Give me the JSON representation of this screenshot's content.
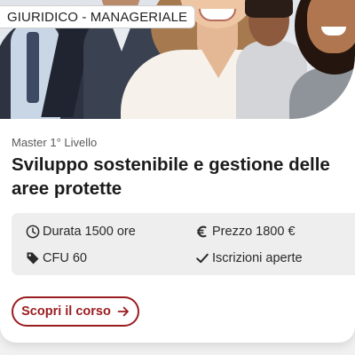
{
  "card": {
    "category_badge": "GIURIDICO - MANAGERIALE",
    "level": "Master 1° Livello",
    "title_lines": [
      "Sviluppo sostenibile e gestione delle",
      "aree protette"
    ],
    "details": {
      "duration": {
        "icon": "clock-icon",
        "text": "Durata 1500 ore"
      },
      "price": {
        "icon": "euro-icon",
        "text": "Prezzo 1800 €"
      },
      "credits": {
        "icon": "tag-icon",
        "text": "CFU 60"
      },
      "status": {
        "icon": "check-icon",
        "text": "Iscrizioni aperte"
      }
    },
    "cta": {
      "label": "Scopri il corso",
      "icon": "arrow-right-icon"
    }
  },
  "colors": {
    "accent": "#9b1c1f",
    "info_background": "#eeeeee",
    "text": "#1b1b1b"
  }
}
